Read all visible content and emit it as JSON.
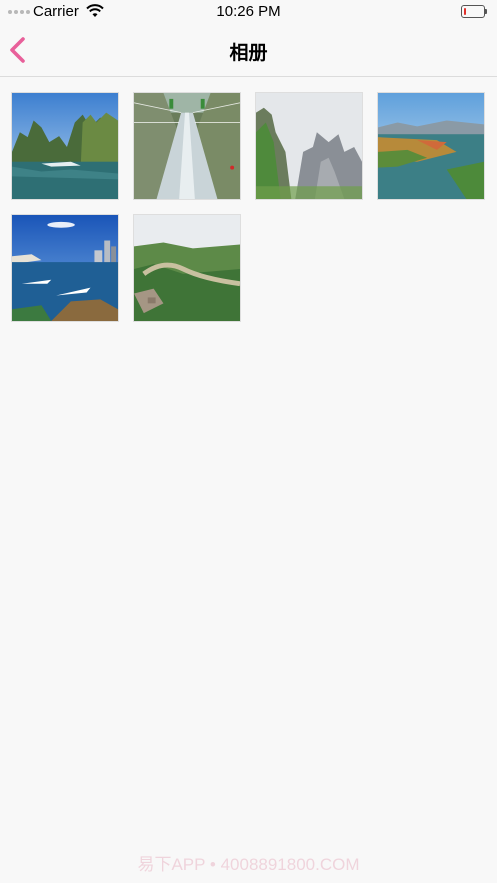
{
  "status_bar": {
    "carrier": "Carrier",
    "time": "10:26 PM"
  },
  "nav": {
    "title": "相册",
    "back_icon": "chevron-left-icon",
    "accent_color": "#e8609a"
  },
  "photos": [
    {
      "subject": "karst-river"
    },
    {
      "subject": "glass-bridge"
    },
    {
      "subject": "misty-cliffs"
    },
    {
      "subject": "lake-wetland"
    },
    {
      "subject": "harbor-city"
    },
    {
      "subject": "river-valley"
    }
  ],
  "watermark": "易下APP • 4008891800.COM"
}
